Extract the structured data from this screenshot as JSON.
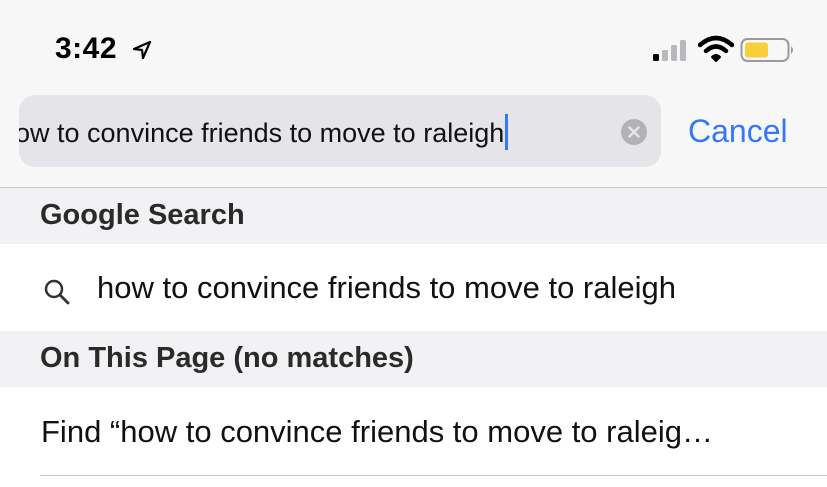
{
  "status_bar": {
    "time": "3:42",
    "icons": [
      "location-arrow-icon",
      "cellular-signal-icon",
      "wifi-icon",
      "battery-icon"
    ],
    "battery_color": "#f7cf3b"
  },
  "search": {
    "query": "ow to convince friends to move to raleigh",
    "cancel_label": "Cancel",
    "accent_color": "#3478f6"
  },
  "sections": {
    "google_header": "Google Search",
    "google_suggestion": "how to convince friends to move to raleigh",
    "page_header": "On This Page (no matches)",
    "find_label": "Find “how to convince friends to move to raleig…"
  }
}
